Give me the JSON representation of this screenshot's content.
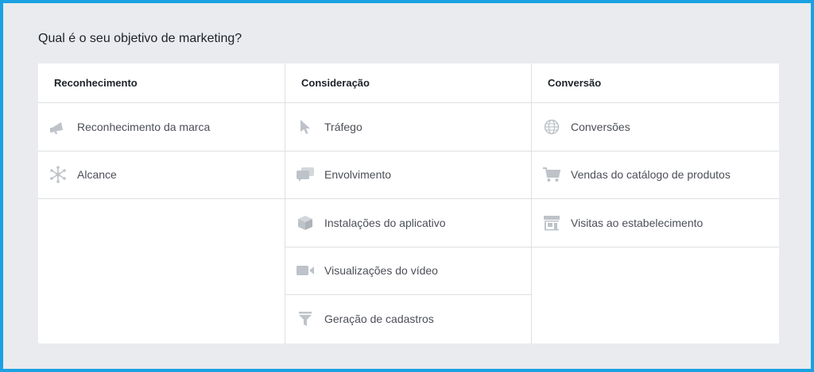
{
  "page": {
    "question": "Qual é o seu objetivo de marketing?"
  },
  "colors": {
    "frame_border": "#1ba1e2",
    "background": "#e9ebee",
    "icon": "#bec3c9",
    "text": "#4b4f56",
    "heading": "#1d2129"
  },
  "columns": [
    {
      "title": "Reconhecimento",
      "items": [
        {
          "label": "Reconhecimento da marca",
          "icon": "megaphone-icon"
        },
        {
          "label": "Alcance",
          "icon": "reach-icon"
        }
      ]
    },
    {
      "title": "Consideração",
      "items": [
        {
          "label": "Tráfego",
          "icon": "cursor-icon"
        },
        {
          "label": "Envolvimento",
          "icon": "chat-bubbles-icon"
        },
        {
          "label": "Instalações do aplicativo",
          "icon": "box-icon"
        },
        {
          "label": "Visualizações do vídeo",
          "icon": "video-camera-icon"
        },
        {
          "label": "Geração de cadastros",
          "icon": "funnel-icon"
        }
      ]
    },
    {
      "title": "Conversão",
      "items": [
        {
          "label": "Conversões",
          "icon": "globe-icon"
        },
        {
          "label": "Vendas do catálogo de produtos",
          "icon": "shopping-cart-icon"
        },
        {
          "label": "Visitas ao estabelecimento",
          "icon": "store-icon"
        }
      ]
    }
  ]
}
